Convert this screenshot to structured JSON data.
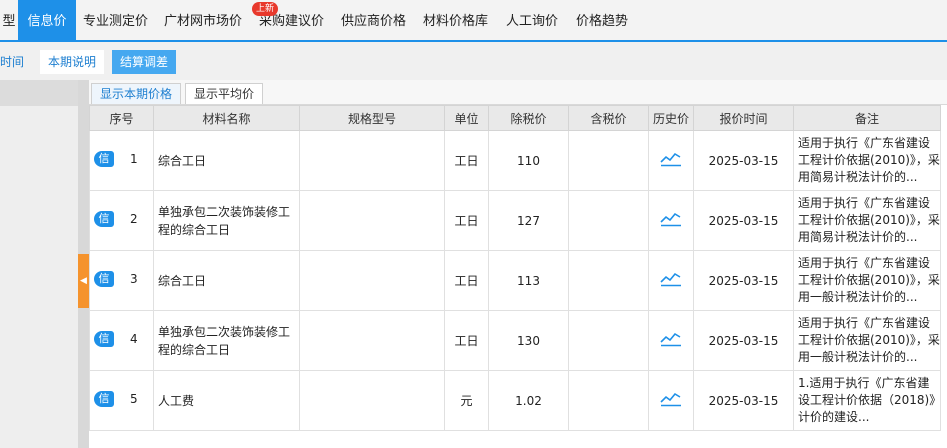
{
  "nav": {
    "items": [
      "型",
      "信息价",
      "专业测定价",
      "广材网市场价",
      "采购建议价",
      "供应商价格",
      "材料价格库",
      "人工询价",
      "价格趋势"
    ],
    "active": 1,
    "badge": "上新"
  },
  "subbar": {
    "time_label": "时间",
    "desc_label": "本期说明",
    "adjust_label": "结算调差"
  },
  "tabs": [
    "显示本期价格",
    "显示平均价"
  ],
  "table": {
    "headers": [
      "序号",
      "材料名称",
      "规格型号",
      "单位",
      "除税价",
      "含税价",
      "历史价",
      "报价时间",
      "备注"
    ],
    "tag": "信",
    "rows": [
      {
        "no": "1",
        "name": "综合工日",
        "spec": "",
        "unit": "工日",
        "price": "110",
        "tax_price": "",
        "date": "2025-03-15",
        "note": "适用于执行《广东省建设工程计价依据(2010)》，采用简易计税法计价的..."
      },
      {
        "no": "2",
        "name": "单独承包二次装饰装修工程的综合工日",
        "spec": "",
        "unit": "工日",
        "price": "127",
        "tax_price": "",
        "date": "2025-03-15",
        "note": "适用于执行《广东省建设工程计价依据(2010)》，采用简易计税法计价的..."
      },
      {
        "no": "3",
        "name": "综合工日",
        "spec": "",
        "unit": "工日",
        "price": "113",
        "tax_price": "",
        "date": "2025-03-15",
        "note": "适用于执行《广东省建设工程计价依据(2010)》，采用一般计税法计价的..."
      },
      {
        "no": "4",
        "name": "单独承包二次装饰装修工程的综合工日",
        "spec": "",
        "unit": "工日",
        "price": "130",
        "tax_price": "",
        "date": "2025-03-15",
        "note": "适用于执行《广东省建设工程计价依据(2010)》，采用一般计税法计价的..."
      },
      {
        "no": "5",
        "name": "人工费",
        "spec": "",
        "unit": "元",
        "price": "1.02",
        "tax_price": "",
        "date": "2025-03-15",
        "note": "1.适用于执行《广东省建设工程计价依据（2018)》计价的建设..."
      }
    ]
  },
  "colors": {
    "accent": "#1e90e8",
    "collapse": "#f5932d",
    "badge": "#e8392c"
  },
  "icons": {
    "history": "trend-chart-icon",
    "collapse": "chevron-left-icon"
  }
}
